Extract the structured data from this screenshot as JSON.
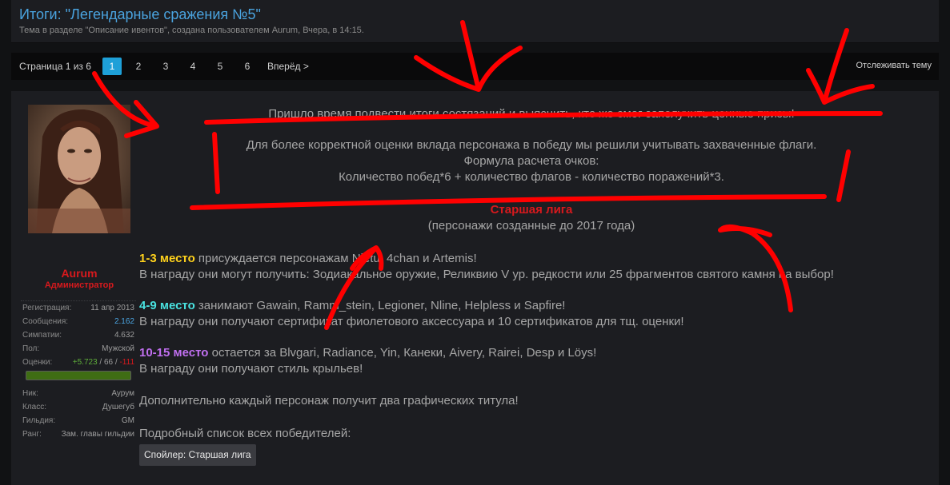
{
  "thread": {
    "title": "Итоги: \"Легендарные сражения №5\"",
    "subtitle": "Тема в разделе \"Описание ивентов\", создана пользователем Aurum, Вчера, в 14:15."
  },
  "pager": {
    "label": "Страница 1 из 6",
    "pages": [
      "1",
      "2",
      "3",
      "4",
      "5",
      "6"
    ],
    "current": "1",
    "next": "Вперёд >",
    "watch": "Отслеживать тему"
  },
  "user": {
    "name": "Aurum",
    "role": "Администратор",
    "stats": [
      {
        "key": "Регистрация:",
        "value": "11 апр 2013"
      },
      {
        "key": "Сообщения:",
        "value": "2.162"
      },
      {
        "key": "Симпатии:",
        "value": "4.632"
      },
      {
        "key": "Пол:",
        "value": "Мужской"
      }
    ],
    "rating": {
      "key": "Оценки:",
      "positive": "+5.723",
      "sep1": " / ",
      "neutral": "66",
      "sep2": " / ",
      "negative": "-111"
    },
    "profile": [
      {
        "key": "Ник:",
        "value": "Аурум"
      },
      {
        "key": "Класс:",
        "value": "Душегуб"
      },
      {
        "key": "Гильдия:",
        "value": "GM"
      },
      {
        "key": "Ранг:",
        "value": "Зам. главы гильдии"
      }
    ]
  },
  "post": {
    "intro": "Пришло время подвести итоги состязаний и выяснить, кто же смог заполучить ценные призы!",
    "formula_1": "Для более корректной оценки вклада персонажа в победу мы решили учитывать захваченные флаги.",
    "formula_2": "Формула расчета очков:",
    "formula_3": "Количество побед*6 + количество флагов - количество поражений*3.",
    "league": "Старшая лига",
    "league_note": "(персонажи созданные до 2017 года)",
    "place1_label": "1-3 место",
    "place1_text": " присуждается персонажам Nietu, 4chan и Artemis!",
    "place1_reward": "В награду они могут получить: Зодиакальное оружие, Реликвию V ур. редкости или 25 фрагментов святого камня на выбор!",
    "place2_label": "4-9 место",
    "place2_text": " занимают Gawain, Ramm_stein, Legioner, Nline, Helpless и Sapfire!",
    "place2_reward": "В награду они получают сертификат фиолетового аксессуара и 10 сертификатов для тщ. оценки!",
    "place3_label": "10-15 место",
    "place3_text": " остается за Blvgari, Radiance, Yin, Канеки, Aivery, Rairei, Desp и Löys!",
    "place3_reward": "В награду они получают стиль крыльев!",
    "extra": "Дополнительно каждый персонаж получит два графических титула!",
    "list_label": "Подробный список всех победителей:",
    "spoiler": "Спойлер: Старшая лига"
  },
  "colors": {
    "accent": "#1ea0d8",
    "title": "#4aa3df",
    "admin": "#d8191d",
    "gold": "#ffd21c",
    "cyan": "#49e2e0",
    "purple": "#c06ff0",
    "scribble": "#ff0000"
  }
}
